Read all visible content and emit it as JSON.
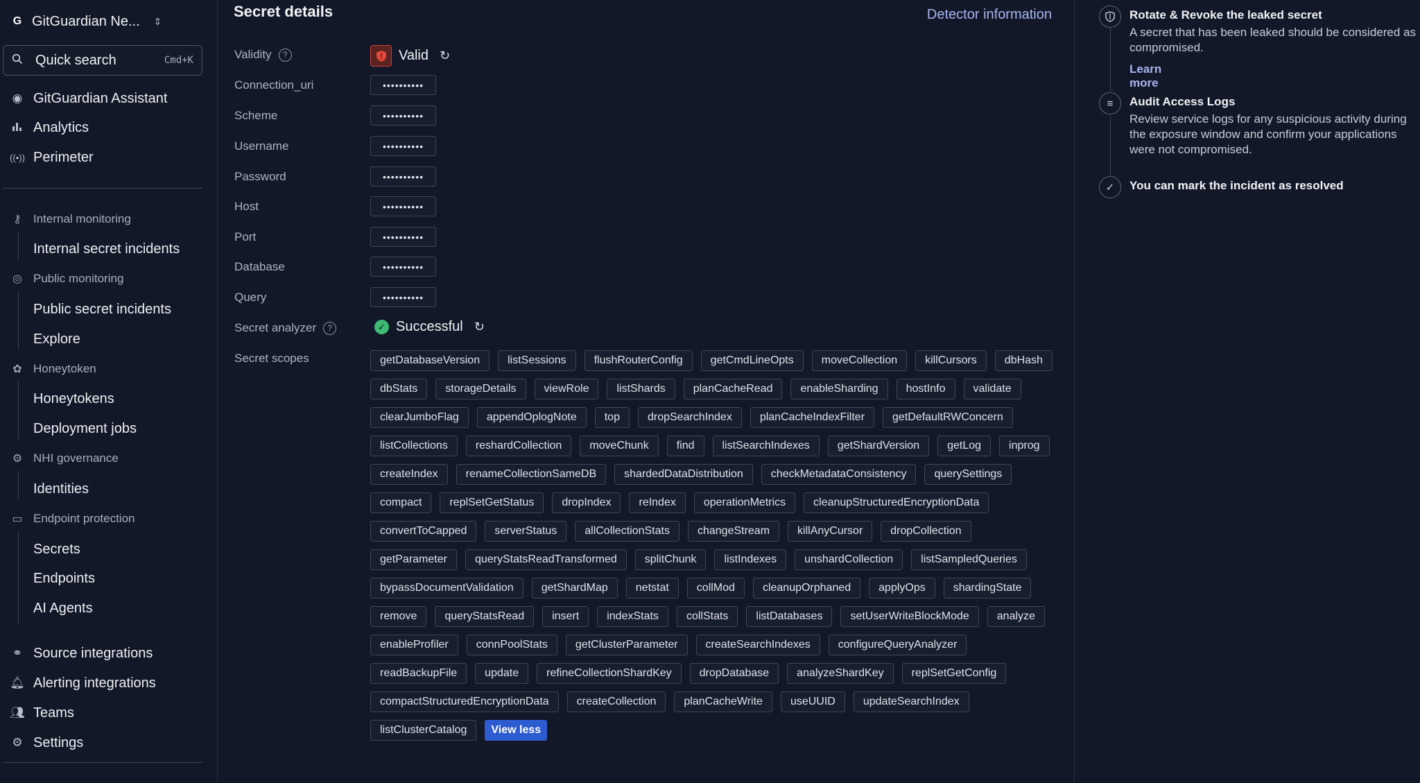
{
  "sidebar": {
    "workspace": {
      "logo": "G",
      "name": "GitGuardian Ne...",
      "chevron": "⌃⌄"
    },
    "search": {
      "label": "Quick search",
      "shortcut": "Cmd+K"
    },
    "top_items": [
      {
        "label": "GitGuardian Assistant",
        "icon": "assistant-icon"
      },
      {
        "label": "Analytics",
        "icon": "bar-chart-icon"
      },
      {
        "label": "Perimeter",
        "icon": "broadcast-icon"
      }
    ],
    "sections": {
      "internal": {
        "label": "Internal monitoring",
        "items": [
          "Internal secret incidents"
        ]
      },
      "public": {
        "label": "Public monitoring",
        "items": [
          "Public secret incidents",
          "Explore"
        ]
      },
      "honeytoken": {
        "label": "Honeytoken",
        "items": [
          "Honeytokens",
          "Deployment jobs"
        ]
      },
      "nhi": {
        "label": "NHI governance",
        "items": [
          "Identities"
        ]
      },
      "endpoint": {
        "label": "Endpoint protection",
        "items": [
          "Secrets",
          "Endpoints",
          "AI Agents"
        ]
      }
    },
    "bottom_items": [
      {
        "label": "Source integrations"
      },
      {
        "label": "Alerting integrations"
      },
      {
        "label": "Teams"
      },
      {
        "label": "Settings"
      }
    ]
  },
  "main": {
    "title": "Secret details",
    "detector_link": "Detector information",
    "validity": {
      "label": "Validity",
      "status": "Valid"
    },
    "fields": [
      {
        "label": "Connection_uri",
        "masked": "••••••••••"
      },
      {
        "label": "Scheme",
        "masked": "••••••••••"
      },
      {
        "label": "Username",
        "masked": "••••••••••"
      },
      {
        "label": "Password",
        "masked": "••••••••••"
      },
      {
        "label": "Host",
        "masked": "••••••••••"
      },
      {
        "label": "Port",
        "masked": "••••••••••"
      },
      {
        "label": "Database",
        "masked": "••••••••••"
      },
      {
        "label": "Query",
        "masked": "••••••••••"
      }
    ],
    "analyzer": {
      "label": "Secret analyzer",
      "status": "Successful"
    },
    "scopes_label": "Secret scopes",
    "scopes": [
      "getDatabaseVersion",
      "listSessions",
      "flushRouterConfig",
      "getCmdLineOpts",
      "moveCollection",
      "killCursors",
      "dbHash",
      "dbStats",
      "storageDetails",
      "viewRole",
      "listShards",
      "planCacheRead",
      "enableSharding",
      "hostInfo",
      "validate",
      "clearJumboFlag",
      "appendOplogNote",
      "top",
      "dropSearchIndex",
      "planCacheIndexFilter",
      "getDefaultRWConcern",
      "listCollections",
      "reshardCollection",
      "moveChunk",
      "find",
      "listSearchIndexes",
      "getShardVersion",
      "getLog",
      "inprog",
      "createIndex",
      "renameCollectionSameDB",
      "shardedDataDistribution",
      "checkMetadataConsistency",
      "querySettings",
      "compact",
      "replSetGetStatus",
      "dropIndex",
      "reIndex",
      "operationMetrics",
      "cleanupStructuredEncryptionData",
      "convertToCapped",
      "serverStatus",
      "allCollectionStats",
      "changeStream",
      "killAnyCursor",
      "dropCollection",
      "getParameter",
      "queryStatsReadTransformed",
      "splitChunk",
      "listIndexes",
      "unshardCollection",
      "listSampledQueries",
      "bypassDocumentValidation",
      "getShardMap",
      "netstat",
      "collMod",
      "cleanupOrphaned",
      "applyOps",
      "shardingState",
      "remove",
      "queryStatsRead",
      "insert",
      "indexStats",
      "collStats",
      "listDatabases",
      "setUserWriteBlockMode",
      "analyze",
      "enableProfiler",
      "connPoolStats",
      "getClusterParameter",
      "createSearchIndexes",
      "configureQueryAnalyzer",
      "readBackupFile",
      "update",
      "refineCollectionShardKey",
      "dropDatabase",
      "analyzeShardKey",
      "replSetGetConfig",
      "compactStructuredEncryptionData",
      "createCollection",
      "planCacheWrite",
      "useUUID",
      "updateSearchIndex",
      "listClusterCatalog"
    ],
    "view_less": "View less"
  },
  "remediation": {
    "step1": {
      "title": "Rotate & Revoke the leaked secret",
      "desc": "A secret that has been leaked should be considered as compromised.",
      "link": "Learn more"
    },
    "step2": {
      "title": "Audit Access Logs",
      "desc": "Review service logs for any suspicious activity during the exposure window and confirm your applications were not compromised."
    },
    "step3": {
      "title": "You can mark the incident as resolved"
    }
  }
}
